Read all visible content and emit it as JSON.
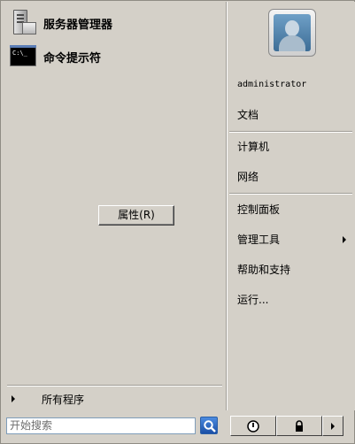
{
  "left": {
    "programs": [
      {
        "label": "服务器管理器",
        "icon": "server-manager-icon"
      },
      {
        "label": "命令提示符",
        "icon": "cmd-icon",
        "icon_text": "C:\\_"
      }
    ],
    "context_button": "属性(R)",
    "all_programs": "所有程序",
    "search_placeholder": "开始搜索"
  },
  "right": {
    "username": "administrator",
    "items": [
      "文档",
      "计算机",
      "网络",
      "控制面板",
      "管理工具",
      "帮助和支持",
      "运行..."
    ]
  },
  "colors": {
    "face": "#d4d0c8",
    "search_border": "#7f9db9",
    "search_button": "#2a5fa8"
  }
}
